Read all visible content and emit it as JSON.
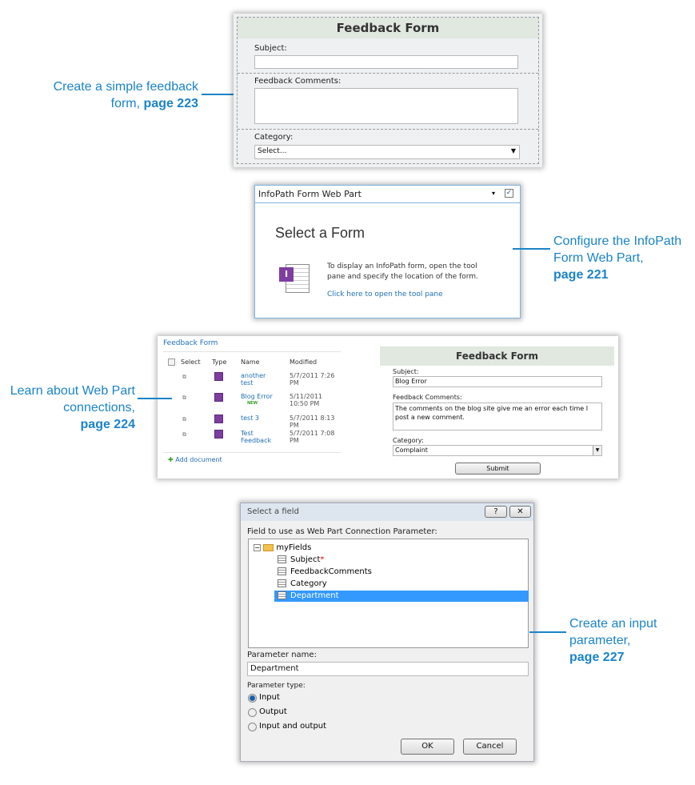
{
  "callouts": [
    {
      "line1": "Create a simple feedback",
      "line2": "form, ",
      "page": "page 223"
    },
    {
      "line1": "Configure the InfoPath",
      "line2": "Form Web Part,",
      "page": "page 221"
    },
    {
      "line1": "Learn about Web Part",
      "line2": "connections,",
      "page": "page 224"
    },
    {
      "line1": "Create an input",
      "line2": "parameter,",
      "page": "page 227"
    }
  ],
  "form1": {
    "title": "Feedback Form",
    "subject_label": "Subject:",
    "comments_label": "Feedback Comments:",
    "category_label": "Category:",
    "category_value": "Select..."
  },
  "webpart": {
    "title": "InfoPath Form Web Part",
    "heading": "Select a Form",
    "desc1": "To display an InfoPath form, open the tool",
    "desc2": "pane and specify the location of the form.",
    "link": "Click here to open the tool pane"
  },
  "library": {
    "title": "Feedback Form",
    "columns": [
      "Select",
      "Type",
      "Name",
      "Modified"
    ],
    "rows": [
      {
        "name1": "another",
        "name2": "test",
        "modified": "5/7/2011 7:26 PM",
        "new": ""
      },
      {
        "name1": "Blog Error",
        "name2": "",
        "modified": "5/11/2011 10:50 PM",
        "new": "NEW"
      },
      {
        "name1": "test 3",
        "name2": "",
        "modified": "5/7/2011 8:13 PM",
        "new": ""
      },
      {
        "name1": "Test",
        "name2": "Feedback",
        "modified": "5/7/2011 7:08 PM",
        "new": ""
      }
    ],
    "add": "Add document"
  },
  "form2": {
    "title": "Feedback Form",
    "subject_label": "Subject:",
    "subject_value": "Blog Error",
    "comments_label": "Feedback Comments:",
    "comments_value": "The comments on the blog site give me an error each time I post a new comment.",
    "category_label": "Category:",
    "category_value": "Complaint",
    "submit": "Submit"
  },
  "dialog": {
    "title": "Select a field",
    "help": "?",
    "close": "✕",
    "field_label": "Field to use as Web Part Connection Parameter:",
    "root": "myFields",
    "fields": [
      "Subject",
      "FeedbackComments",
      "Category",
      "Department"
    ],
    "required_mark": "*",
    "selected": "Department",
    "param_name_label": "Parameter name:",
    "param_name_value": "Department",
    "param_type_label": "Parameter type:",
    "types": [
      "Input",
      "Output",
      "Input and output"
    ],
    "selected_type": "Input",
    "ok": "OK",
    "cancel": "Cancel"
  },
  "colors": {
    "accent": "#1a84c7",
    "selection": "#3399ff",
    "header_bg": "#e0e8e0"
  }
}
